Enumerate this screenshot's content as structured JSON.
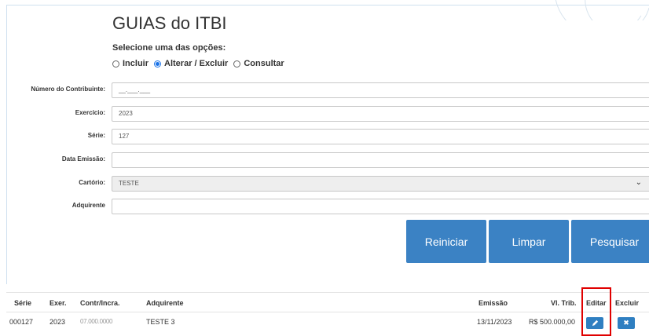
{
  "page": {
    "title": "GUIAS do ITBI",
    "subtitle": "Selecione uma das opções:"
  },
  "options": {
    "items": [
      {
        "label": "Incluir",
        "checked": false
      },
      {
        "label": "Alterar / Excluir",
        "checked": true
      },
      {
        "label": "Consultar",
        "checked": false
      }
    ]
  },
  "form": {
    "contribuinte": {
      "label": "Número do Contribuinte:",
      "value": "__.___.___"
    },
    "exercicio": {
      "label": "Exercício:",
      "value": "2023"
    },
    "serie": {
      "label": "Série:",
      "value": "127"
    },
    "data_emissao": {
      "label": "Data Emissão:",
      "value": ""
    },
    "cartorio": {
      "label": "Cartório:",
      "value": "TESTE"
    },
    "adquirente": {
      "label": "Adquirente",
      "value": ""
    }
  },
  "buttons": {
    "reiniciar": "Reiniciar",
    "limpar": "Limpar",
    "pesquisar": "Pesquisar"
  },
  "table": {
    "headers": {
      "serie": "Série",
      "exer": "Exer.",
      "contr": "Contr/Incra.",
      "adquirente": "Adquirente",
      "emissao": "Emissão",
      "vl_trib": "Vl. Trib.",
      "editar": "Editar",
      "excluir": "Excluir"
    },
    "rows": [
      {
        "serie": "000127",
        "exer": "2023",
        "contr": "07.000.0000",
        "adquirente": "TESTE 3",
        "emissao": "13/11/2023",
        "vl_trib": "R$ 500.000,00"
      }
    ]
  },
  "colors": {
    "primary": "#3b82c4",
    "action": "#2f7fc1",
    "highlight": "#e00000"
  }
}
